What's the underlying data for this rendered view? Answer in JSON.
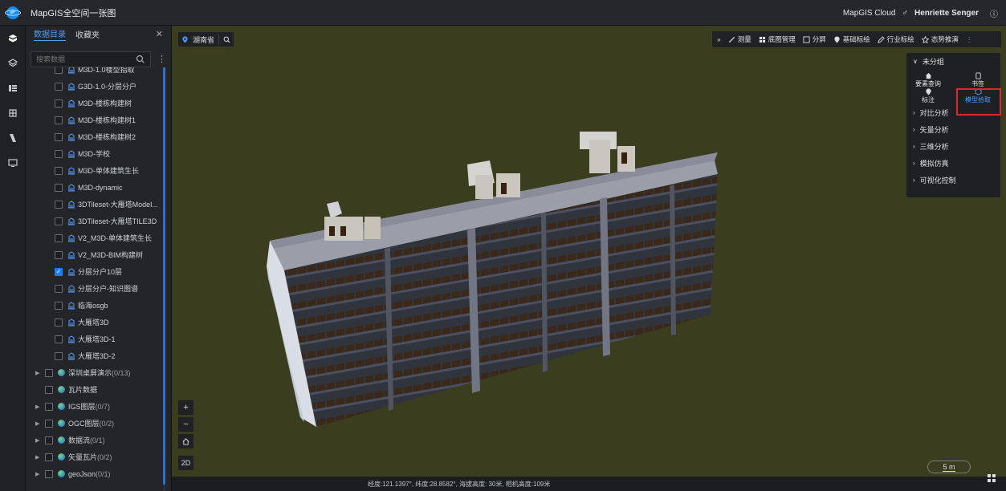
{
  "app": {
    "title": "MapGIS全空间一张图",
    "brand": "MapGIS Cloud",
    "user": "Henriette Senger"
  },
  "panel": {
    "tabs": [
      {
        "label": "数据目录",
        "active": true
      },
      {
        "label": "收藏夹",
        "active": false
      }
    ],
    "search_placeholder": "搜索数据",
    "layers": [
      {
        "label": "M3D-1.0楼型指取",
        "checked": false
      },
      {
        "label": "G3D-1.0-分层分户",
        "checked": false
      },
      {
        "label": "M3D-楼栋构建树",
        "checked": false
      },
      {
        "label": "M3D-楼栋构建树1",
        "checked": false
      },
      {
        "label": "M3D-楼栋构建树2",
        "checked": false
      },
      {
        "label": "M3D-学校",
        "checked": false
      },
      {
        "label": "M3D-单体建筑生长",
        "checked": false
      },
      {
        "label": "M3D-dynamic",
        "checked": false
      },
      {
        "label": "3DTileset-大雁塔Model...",
        "checked": false
      },
      {
        "label": "3DTileset-大雁塔TILE3D",
        "checked": false
      },
      {
        "label": "V2_M3D-单体建筑生长",
        "checked": false
      },
      {
        "label": "V2_M3D-BIM构建树",
        "checked": false
      },
      {
        "label": "分层分户10层",
        "checked": true
      },
      {
        "label": "分层分户-知识图谱",
        "checked": false
      },
      {
        "label": "临海osgb",
        "checked": false
      },
      {
        "label": "大雁塔3D",
        "checked": false
      },
      {
        "label": "大雁塔3D-1",
        "checked": false
      },
      {
        "label": "大雁塔3D-2",
        "checked": false
      }
    ],
    "groups": [
      {
        "label": "深圳桌屏演示",
        "count": "(0/13)",
        "arrow": true
      },
      {
        "label": "瓦片数据",
        "count": "",
        "arrow": false
      },
      {
        "label": "IGS图层",
        "count": "(0/7)",
        "arrow": true
      },
      {
        "label": "OGC图层",
        "count": "(0/2)",
        "arrow": true
      },
      {
        "label": "数据流",
        "count": "(0/1)",
        "arrow": true
      },
      {
        "label": "矢量瓦片",
        "count": "(0/2)",
        "arrow": true
      },
      {
        "label": "geoJson",
        "count": "(0/1)",
        "arrow": true
      }
    ]
  },
  "map": {
    "location": "湖南省",
    "toolbar": {
      "expand": "»",
      "measure": "测量",
      "basemap": "底图管理",
      "split": "分屏",
      "basic_label": "基础标绘",
      "industry_label": "行业标绘",
      "situation": "态势推演"
    },
    "side": {
      "group": "未分组",
      "tools": {
        "query": "要素查询",
        "bookmark": "书签",
        "mark": "标注",
        "pick": "模型拾取"
      },
      "categories": [
        "对比分析",
        "矢量分析",
        "三维分析",
        "模拟仿真",
        "可视化控制"
      ]
    },
    "controls": {
      "zoom_in": "+",
      "zoom_out": "−",
      "mode_2d": "2D"
    },
    "status": "经度:121.1397°, 纬度:28.8582°, 海拔高度: 30米, 相机高度:109米",
    "scale": "5 m"
  },
  "colors": {
    "accent": "#1f7ff0",
    "highlight": "#e0272a",
    "terrain": "#3b3e1e"
  }
}
